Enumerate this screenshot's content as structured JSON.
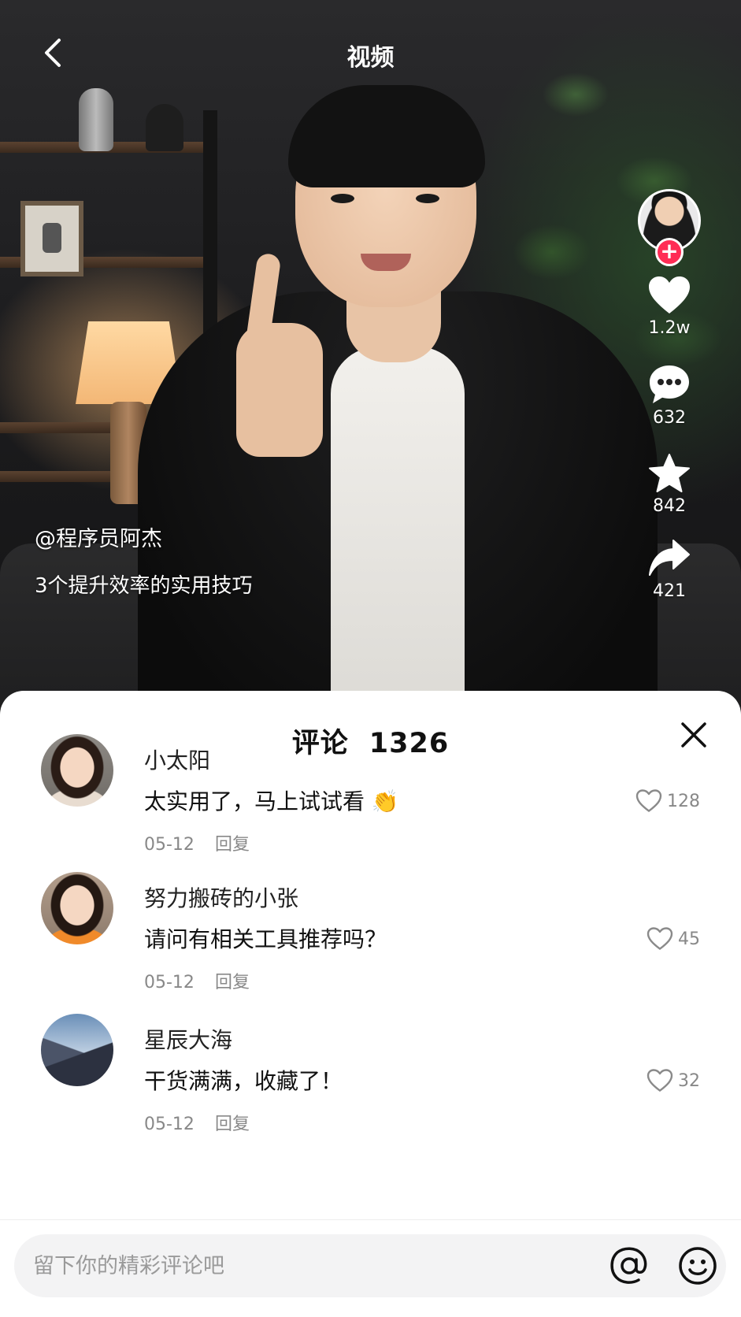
{
  "header": {
    "title": "视频"
  },
  "video": {
    "author_handle": "@程序员阿杰",
    "description": "3个提升效率的实用技巧"
  },
  "actions": {
    "follow_symbol": "+",
    "likes": "1.2w",
    "comments": "632",
    "favorites": "842",
    "shares": "421"
  },
  "comments_panel": {
    "title": "评论",
    "count": "1326",
    "items": [
      {
        "name": "小太阳",
        "text": "太实用了，马上试试看 👏",
        "date": "05-12",
        "reply": "回复",
        "likes": "128"
      },
      {
        "name": "努力搬砖的小张",
        "text": "请问有相关工具推荐吗？",
        "date": "05-12",
        "reply": "回复",
        "likes": "45"
      },
      {
        "name": "星辰大海",
        "text": "干货满满，收藏了！",
        "date": "05-12",
        "reply": "回复",
        "likes": "32"
      }
    ]
  },
  "input": {
    "placeholder": "留下你的精彩评论吧"
  },
  "icons": {
    "back": "chevron-left-icon",
    "like": "heart-icon",
    "comment": "chat-bubble-icon",
    "favorite": "star-icon",
    "share": "share-arrow-icon",
    "close": "close-icon",
    "at": "at-icon",
    "emoji": "smile-icon"
  },
  "colors": {
    "accent": "#ff2c55",
    "sheet_bg": "#ffffff",
    "muted_text": "#888888"
  }
}
